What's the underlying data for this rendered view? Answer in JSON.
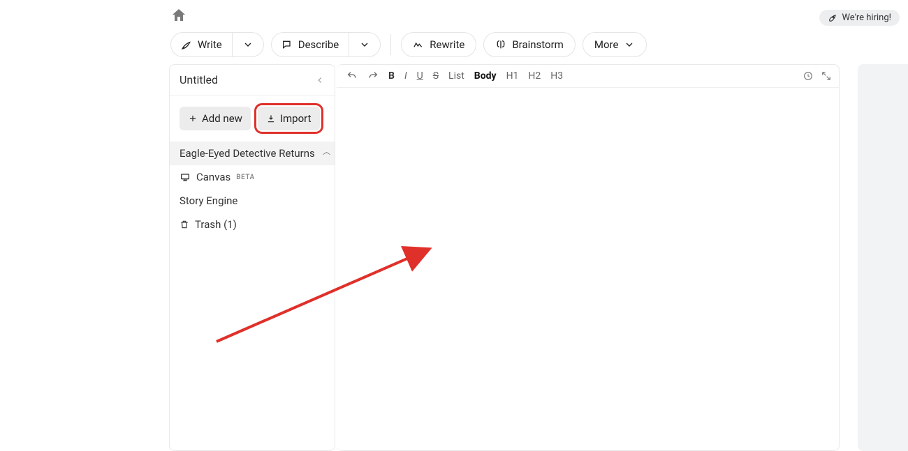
{
  "header": {
    "hiring_label": "We're hiring!"
  },
  "actions": {
    "write": "Write",
    "describe": "Describe",
    "rewrite": "Rewrite",
    "brainstorm": "Brainstorm",
    "more": "More"
  },
  "sidebar": {
    "title": "Untitled",
    "add_new": "Add new",
    "import": "Import",
    "project_name": "Eagle-Eyed Detective Returns",
    "canvas_label": "Canvas",
    "canvas_badge": "BETA",
    "story_engine": "Story Engine",
    "trash_label": "Trash (1)"
  },
  "editor_toolbar": {
    "bold": "B",
    "italic": "I",
    "underline": "U",
    "strike": "S",
    "list": "List",
    "body": "Body",
    "h1": "H1",
    "h2": "H2",
    "h3": "H3"
  },
  "annotation": {
    "highlight_target": "import-button",
    "arrow_color": "#e0302a"
  }
}
